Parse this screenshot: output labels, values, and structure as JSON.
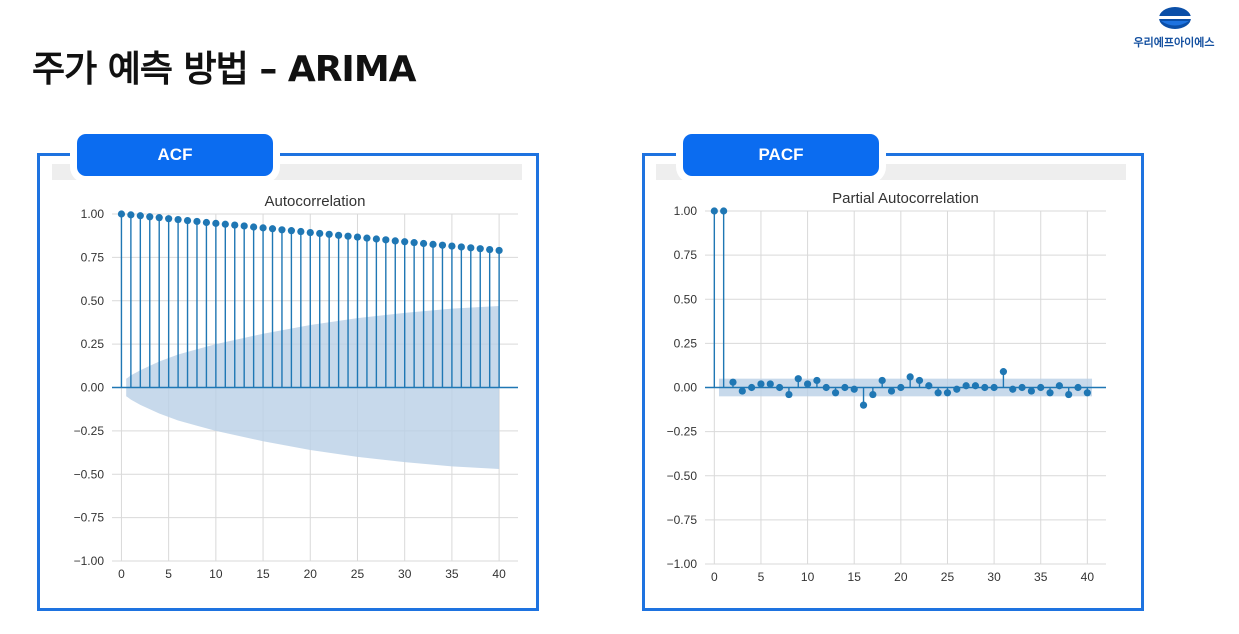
{
  "slide": {
    "title": "주가 예측 방법 – ARIMA",
    "logo_text": "우리에프아이에스"
  },
  "colors": {
    "accent": "#1e73e0",
    "tab": "#0b6cf0",
    "marker": "#1f77b4",
    "band": "#b9d0e6"
  },
  "panels": {
    "acf": {
      "label": "ACF"
    },
    "pacf": {
      "label": "PACF"
    }
  },
  "chart_data": [
    {
      "type": "stem",
      "title": "Autocorrelation",
      "xlabel": "",
      "ylabel": "",
      "xlim": [
        -1,
        42
      ],
      "ylim": [
        -1,
        1
      ],
      "xticks": [
        0,
        5,
        10,
        15,
        20,
        25,
        30,
        35,
        40
      ],
      "yticks": [
        1.0,
        0.75,
        0.5,
        0.25,
        0.0,
        -0.25,
        -0.5,
        -0.75,
        -1.0
      ],
      "ytick_labels": [
        "1.00",
        "0.75",
        "0.50",
        "0.25",
        "0.00",
        "−0.25",
        "−0.50",
        "−0.75",
        "−1.00"
      ],
      "grid": true,
      "lags": [
        0,
        1,
        2,
        3,
        4,
        5,
        6,
        7,
        8,
        9,
        10,
        11,
        12,
        13,
        14,
        15,
        16,
        17,
        18,
        19,
        20,
        21,
        22,
        23,
        24,
        25,
        26,
        27,
        28,
        29,
        30,
        31,
        32,
        33,
        34,
        35,
        36,
        37,
        38,
        39,
        40
      ],
      "values": [
        1.0,
        0.995,
        0.99,
        0.984,
        0.979,
        0.973,
        0.968,
        0.962,
        0.957,
        0.951,
        0.946,
        0.941,
        0.936,
        0.931,
        0.925,
        0.92,
        0.915,
        0.909,
        0.904,
        0.899,
        0.893,
        0.888,
        0.883,
        0.877,
        0.872,
        0.867,
        0.861,
        0.856,
        0.851,
        0.845,
        0.84,
        0.835,
        0.83,
        0.825,
        0.82,
        0.815,
        0.81,
        0.805,
        0.8,
        0.795,
        0.79
      ],
      "confidence_band": {
        "x": [
          0.5,
          1,
          2,
          4,
          6,
          8,
          10,
          15,
          20,
          25,
          30,
          35,
          40
        ],
        "upper": [
          0.05,
          0.07,
          0.1,
          0.15,
          0.19,
          0.22,
          0.25,
          0.31,
          0.36,
          0.4,
          0.43,
          0.455,
          0.47
        ]
      }
    },
    {
      "type": "stem",
      "title": "Partial Autocorrelation",
      "xlabel": "",
      "ylabel": "",
      "xlim": [
        -1,
        42
      ],
      "ylim": [
        -1,
        1
      ],
      "xticks": [
        0,
        5,
        10,
        15,
        20,
        25,
        30,
        35,
        40
      ],
      "yticks": [
        1.0,
        0.75,
        0.5,
        0.25,
        0.0,
        -0.25,
        -0.5,
        -0.75,
        -1.0
      ],
      "ytick_labels": [
        "1.00",
        "0.75",
        "0.50",
        "0.25",
        "0.00",
        "−0.25",
        "−0.50",
        "−0.75",
        "−1.00"
      ],
      "grid": true,
      "lags": [
        0,
        1,
        2,
        3,
        4,
        5,
        6,
        7,
        8,
        9,
        10,
        11,
        12,
        13,
        14,
        15,
        16,
        17,
        18,
        19,
        20,
        21,
        22,
        23,
        24,
        25,
        26,
        27,
        28,
        29,
        30,
        31,
        32,
        33,
        34,
        35,
        36,
        37,
        38,
        39,
        40
      ],
      "values": [
        1.0,
        1.0,
        0.03,
        -0.02,
        0.0,
        0.02,
        0.02,
        0.0,
        -0.04,
        0.05,
        0.02,
        0.04,
        0.0,
        -0.03,
        0.0,
        -0.01,
        -0.1,
        -0.04,
        0.04,
        -0.02,
        0.0,
        0.06,
        0.04,
        0.01,
        -0.03,
        -0.03,
        -0.01,
        0.01,
        0.01,
        0.0,
        0.0,
        0.09,
        -0.01,
        0.0,
        -0.02,
        0.0,
        -0.03,
        0.01,
        -0.04,
        0.0,
        -0.03
      ],
      "confidence_band": {
        "upper": 0.05
      }
    }
  ]
}
